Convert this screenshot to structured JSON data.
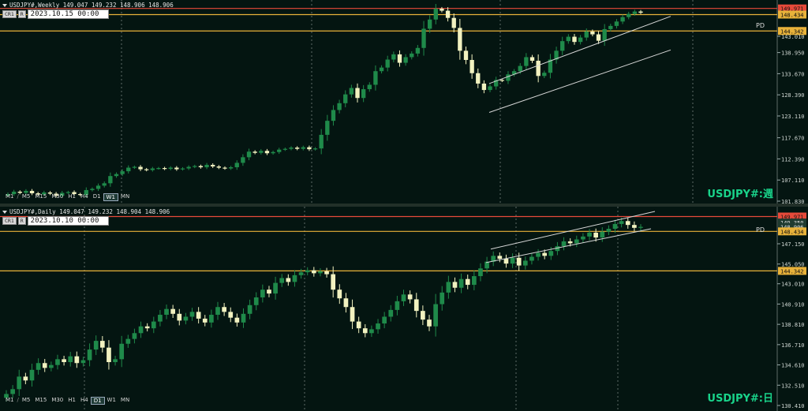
{
  "colors": {
    "bull": "#1f8a4a",
    "bear": "#f2f2c0",
    "hline_orange": "#e8b23a",
    "hline_red": "#e64a3a",
    "channel": "#d8d8d8",
    "grid": "#9aa5a0"
  },
  "top": {
    "header": "USDJPY#,Weekly  149.047 149.232 148.906 148.906",
    "cr_button": "CR1",
    "r_button": "R",
    "datetime": "2023.10.15 00:00",
    "timeframes": [
      "M1",
      "/",
      "M5",
      "M15",
      "M30",
      "H1",
      "H4",
      "D1",
      "W1",
      "MN"
    ],
    "active_timeframe": "W1",
    "symbol_label": "USDJPY#:週",
    "pd_label": "PD",
    "price_labels": [
      "149.971",
      "148.434",
      "144.342"
    ],
    "scale_ticks": [
      "143.010",
      "138.950",
      "133.670",
      "128.390",
      "123.110",
      "117.670",
      "112.390",
      "107.110",
      "101.830"
    ]
  },
  "bottom": {
    "header": "USDJPY#,Daily  149.047 149.232 148.904 148.906",
    "cr_button": "CR1",
    "r_button": "R",
    "datetime": "2023.10.10 00:00",
    "timeframes": [
      "M1",
      "/",
      "M5",
      "M15",
      "M30",
      "H1",
      "H4",
      "D1",
      "W1",
      "MN"
    ],
    "active_timeframe": "D1",
    "symbol_label": "USDJPY#:日",
    "pd_label": "PD",
    "price_labels": [
      "149.971",
      "149.350",
      "148.906",
      "148.434",
      "144.342"
    ],
    "scale_ticks": [
      "147.150",
      "145.050",
      "143.010",
      "140.910",
      "138.810",
      "136.710",
      "134.610",
      "132.510",
      "130.410"
    ]
  },
  "chart_data": [
    {
      "type": "candlestick",
      "title": "USDJPY#,Weekly",
      "ylim": [
        101.83,
        150.5
      ],
      "hlines": [
        149.971,
        148.434,
        144.342
      ],
      "series": [
        {
          "values": [
            103.6,
            104.2,
            103.9,
            104.4,
            103.8,
            103.5,
            104.0,
            103.7,
            103.2,
            103.9,
            104.1,
            103.6,
            103.4,
            104.6,
            104.9,
            105.7,
            106.3,
            108.1,
            108.6,
            109.3,
            110.2,
            110.4,
            109.8,
            109.6,
            110.0,
            110.1,
            109.9,
            110.2,
            109.8,
            110.0,
            110.4,
            110.6,
            110.3,
            110.9,
            110.5,
            110.2,
            110.0,
            110.3,
            111.4,
            112.8,
            114.2,
            113.9,
            114.4,
            113.8,
            114.1,
            114.7,
            114.9,
            115.2,
            114.9,
            115.3,
            114.8,
            115.0,
            118.4,
            121.9,
            124.6,
            126.3,
            128.5,
            130.1,
            127.6,
            129.8,
            130.9,
            134.3,
            135.2,
            137.2,
            138.5,
            136.4,
            137.8,
            138.7,
            140.1,
            144.9,
            147.2,
            149.9,
            149.4,
            147.6,
            145.1,
            139.4,
            137.1,
            133.8,
            131.2,
            129.6,
            130.5,
            132.1,
            131.9,
            133.5,
            134.3,
            135.6,
            137.8,
            136.9,
            133.1,
            133.9,
            137.2,
            139.4,
            141.8,
            142.9,
            141.6,
            142.7,
            144.2,
            143.5,
            141.9,
            144.8,
            145.6,
            146.7,
            147.8,
            148.6,
            149.2,
            148.9
          ]
        }
      ]
    },
    {
      "type": "candlestick",
      "title": "USDJPY#,Daily",
      "ylim": [
        130.41,
        150.5
      ],
      "hlines": [
        149.971,
        148.434,
        144.342
      ],
      "series": [
        {
          "values": [
            131.6,
            132.1,
            133.4,
            133.0,
            134.1,
            134.8,
            134.3,
            134.6,
            135.2,
            134.9,
            135.5,
            134.8,
            135.1,
            136.2,
            137.1,
            136.4,
            134.9,
            135.2,
            136.8,
            137.3,
            137.9,
            138.6,
            138.4,
            139.1,
            139.8,
            140.4,
            139.9,
            139.2,
            139.6,
            140.1,
            139.4,
            139.0,
            139.8,
            140.6,
            140.1,
            139.5,
            139.0,
            139.9,
            140.8,
            141.6,
            142.4,
            142.0,
            143.1,
            143.6,
            143.2,
            143.9,
            144.2,
            144.4,
            144.1,
            144.3,
            144.0,
            142.4,
            141.5,
            140.6,
            139.1,
            138.4,
            137.9,
            138.3,
            138.9,
            139.6,
            140.3,
            141.2,
            141.9,
            141.4,
            140.2,
            139.3,
            138.6,
            140.9,
            142.1,
            143.2,
            142.6,
            143.5,
            142.9,
            143.8,
            144.6,
            145.3,
            145.9,
            145.6,
            145.1,
            145.7,
            144.9,
            145.4,
            145.8,
            146.2,
            145.9,
            146.4,
            146.9,
            147.4,
            147.2,
            147.6,
            147.9,
            148.3,
            147.8,
            148.4,
            148.7,
            149.2,
            149.5,
            149.1,
            148.8,
            148.9
          ]
        }
      ]
    }
  ]
}
